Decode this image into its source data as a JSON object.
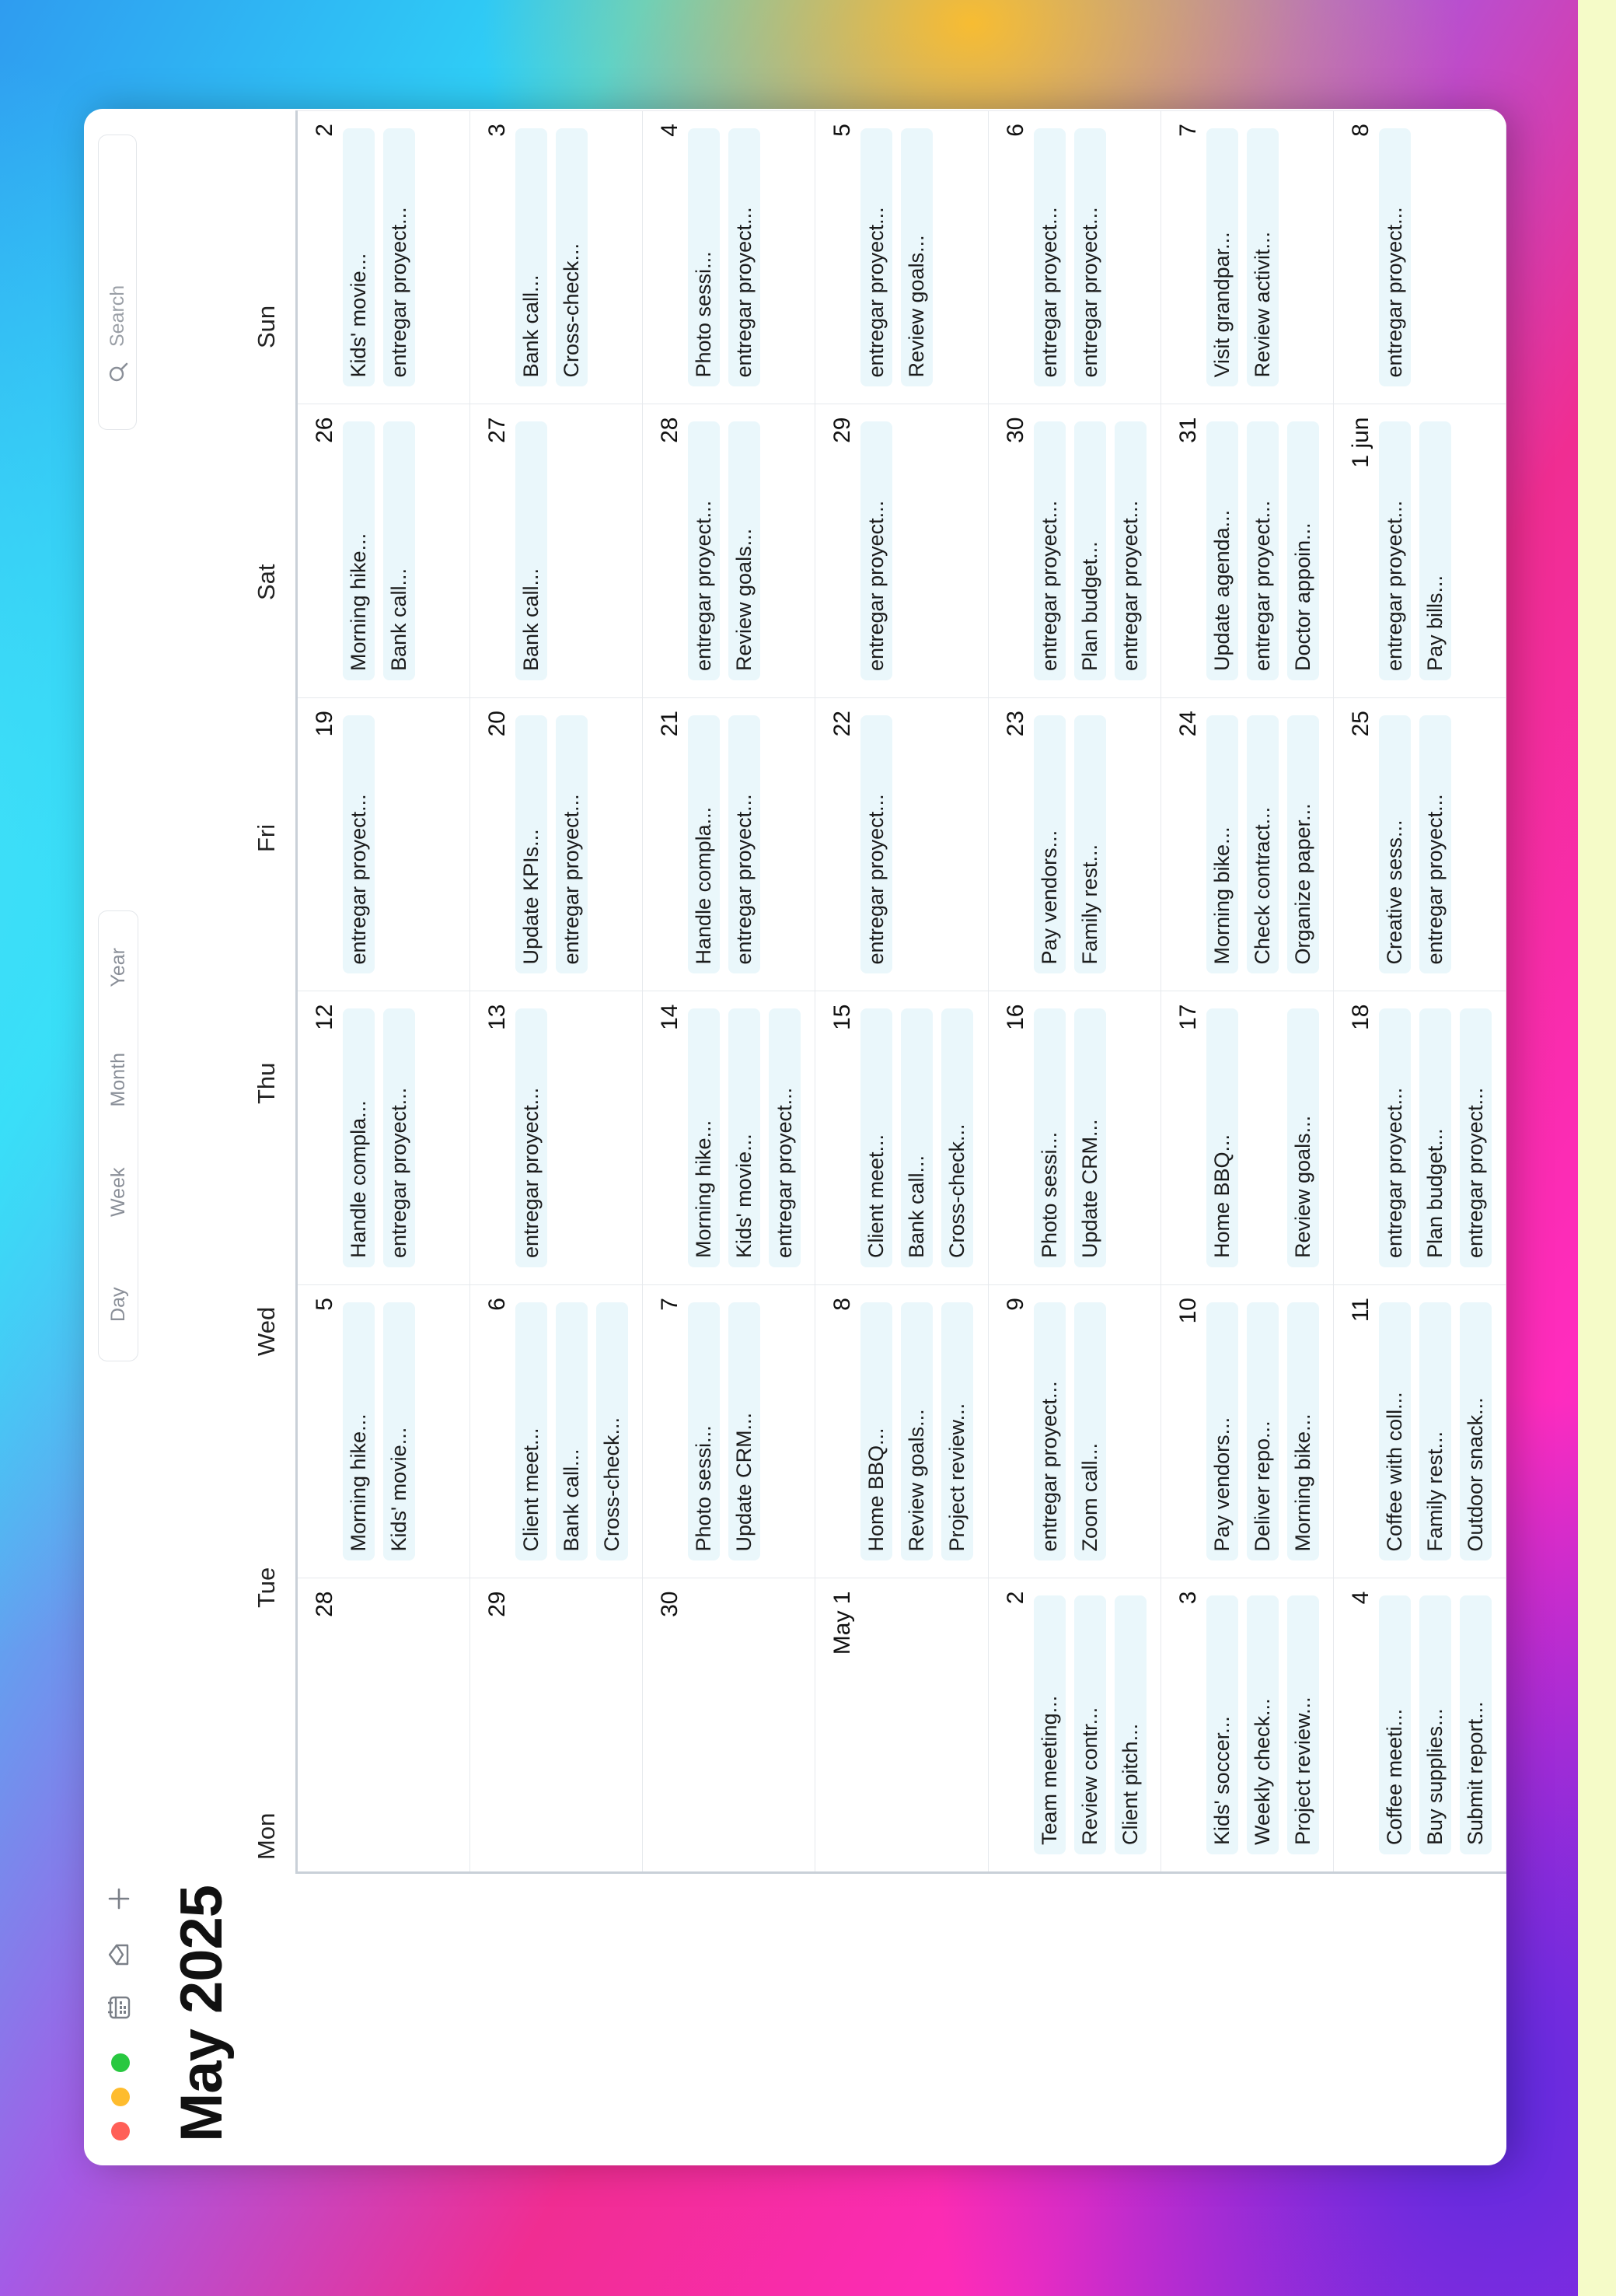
{
  "window": {
    "title": "May 2025",
    "view_tabs": [
      "Day",
      "Week",
      "Month",
      "Year"
    ],
    "search_placeholder": "Search"
  },
  "weekdays": [
    "Mon",
    "Tue",
    "Wed",
    "Thu",
    "Fri",
    "Sat",
    "Sun"
  ],
  "weeks": [
    [
      {
        "label": "28",
        "events": []
      },
      {
        "label": "29",
        "events": []
      },
      {
        "label": "30",
        "events": []
      },
      {
        "label": "May 1",
        "events": []
      },
      {
        "label": "2",
        "events": [
          "Team meeting...",
          "Review contr...",
          "Client pitch..."
        ]
      },
      {
        "label": "3",
        "events": [
          "Kids' soccer...",
          "Weekly check...",
          "Project review..."
        ]
      },
      {
        "label": "4",
        "events": [
          "Coffee meeti...",
          "Buy supplies...",
          "Submit report..."
        ]
      }
    ],
    [
      {
        "label": "5",
        "events": [
          "Morning hike...",
          "Kids' movie..."
        ]
      },
      {
        "label": "6",
        "events": [
          "Client meet...",
          "Bank call...",
          "Cross-check..."
        ]
      },
      {
        "label": "7",
        "events": [
          "Photo sessi...",
          "Update CRM..."
        ]
      },
      {
        "label": "8",
        "events": [
          "Home BBQ...",
          "Review goals...",
          "Project review..."
        ]
      },
      {
        "label": "9",
        "events": [
          "entregar proyect...",
          "Zoom call..."
        ]
      },
      {
        "label": "10",
        "events": [
          "Pay vendors...",
          "Deliver repo...",
          "Morning bike..."
        ]
      },
      {
        "label": "11",
        "events": [
          "Coffee with coll...",
          "Family rest...",
          "Outdoor snack..."
        ]
      }
    ],
    [
      {
        "label": "12",
        "events": [
          "Handle compla...",
          "entregar proyect..."
        ]
      },
      {
        "label": "13",
        "events": [
          "entregar proyect..."
        ]
      },
      {
        "label": "14",
        "events": [
          "Morning hike...",
          "Kids' movie...",
          "entregar proyect..."
        ]
      },
      {
        "label": "15",
        "events": [
          "Client meet...",
          "Bank call...",
          "Cross-check..."
        ]
      },
      {
        "label": "16",
        "events": [
          "Photo sessi...",
          "Update CRM..."
        ]
      },
      {
        "label": "17",
        "events": [
          "Home BBQ...",
          "",
          "Review goals..."
        ]
      },
      {
        "label": "18",
        "events": [
          "entregar proyect...",
          "Plan budget...",
          "entregar proyect..."
        ]
      }
    ],
    [
      {
        "label": "19",
        "events": [
          "entregar proyect..."
        ]
      },
      {
        "label": "20",
        "events": [
          "Update KPIs...",
          "entregar proyect..."
        ]
      },
      {
        "label": "21",
        "events": [
          "Handle compla...",
          "entregar proyect..."
        ]
      },
      {
        "label": "22",
        "events": [
          "entregar proyect..."
        ]
      },
      {
        "label": "23",
        "events": [
          "Pay vendors...",
          "Family rest..."
        ]
      },
      {
        "label": "24",
        "events": [
          "Morning bike...",
          "Check contract...",
          "Organize paper..."
        ]
      },
      {
        "label": "25",
        "events": [
          "Creative sess...",
          "entregar proyect..."
        ]
      }
    ],
    [
      {
        "label": "26",
        "events": [
          "Morning hike...",
          "Bank call..."
        ]
      },
      {
        "label": "27",
        "events": [
          "Bank call..."
        ]
      },
      {
        "label": "28",
        "events": [
          "entregar proyect...",
          "Review goals..."
        ]
      },
      {
        "label": "29",
        "events": [
          "entregar proyect..."
        ]
      },
      {
        "label": "30",
        "events": [
          "entregar proyect...",
          "Plan budget...",
          "entregar proyect..."
        ]
      },
      {
        "label": "31",
        "events": [
          "Update agenda...",
          "entregar proyect...",
          "Doctor appoin..."
        ]
      },
      {
        "label": "1 jun",
        "events": [
          "entregar proyect...",
          "Pay bills..."
        ]
      }
    ],
    [
      {
        "label": "2",
        "events": [
          "Kids' movie...",
          "entregar proyect..."
        ]
      },
      {
        "label": "3",
        "events": [
          "Bank call...",
          "Cross-check..."
        ]
      },
      {
        "label": "4",
        "events": [
          "Photo sessi...",
          "entregar proyect..."
        ]
      },
      {
        "label": "5",
        "events": [
          "entregar proyect...",
          "Review goals..."
        ]
      },
      {
        "label": "6",
        "events": [
          "entregar proyect...",
          "entregar proyect..."
        ]
      },
      {
        "label": "7",
        "events": [
          "Visit grandpar...",
          "Review activit..."
        ]
      },
      {
        "label": "8",
        "events": [
          "entregar proyect..."
        ]
      }
    ]
  ]
}
